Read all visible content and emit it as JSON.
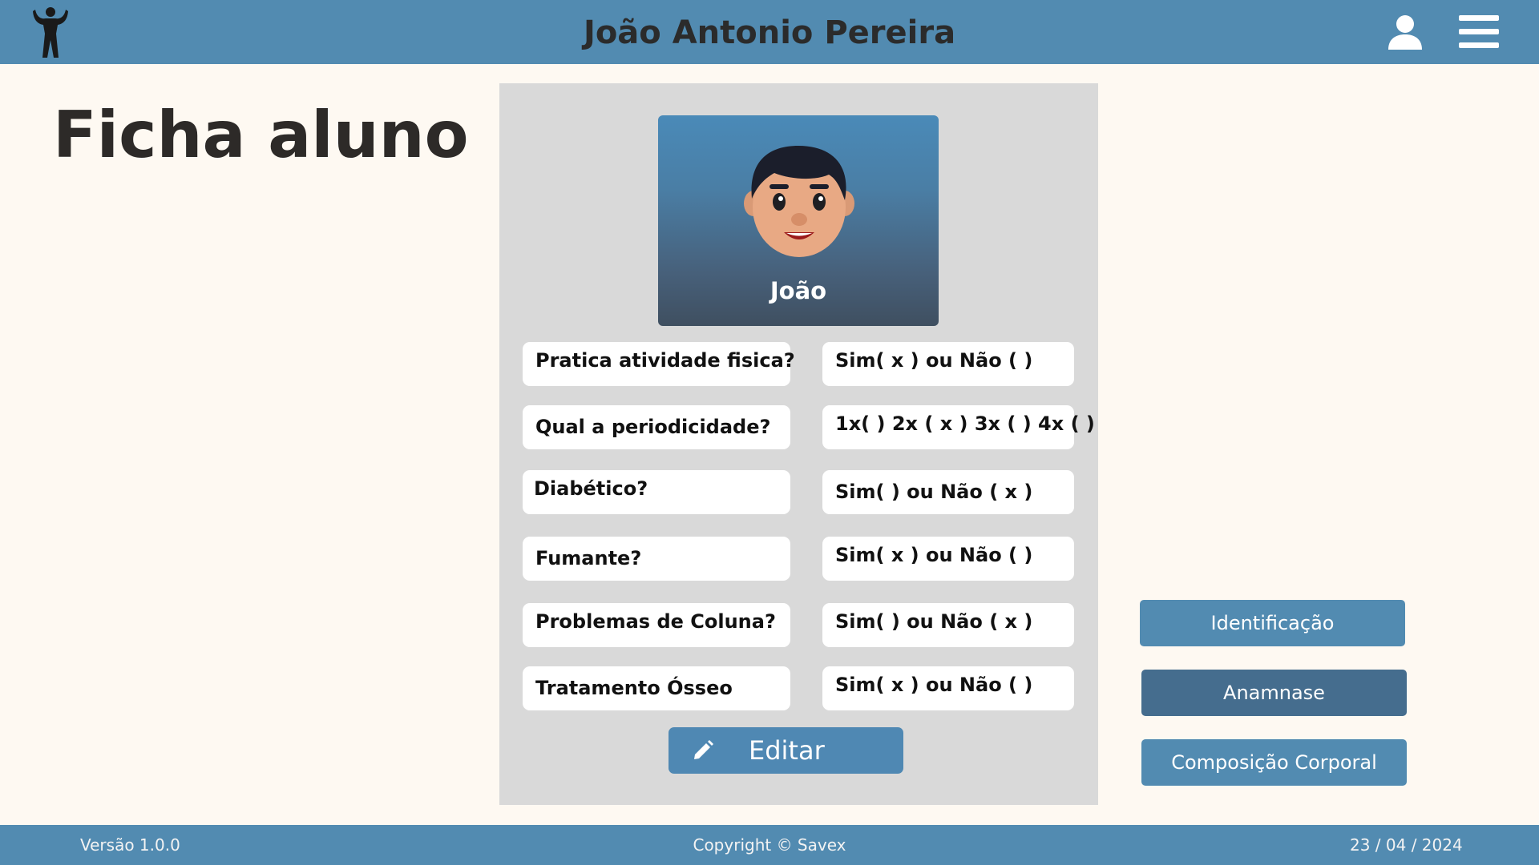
{
  "header": {
    "title": "João Antonio Pereira",
    "logo_icon": "bodybuilder-silhouette-icon",
    "user_icon": "user-icon",
    "menu_icon": "hamburger-menu-icon"
  },
  "page": {
    "title": "Ficha aluno"
  },
  "profile": {
    "name": "João",
    "avatar_icon": "boy-avatar-icon"
  },
  "anamnese": [
    {
      "question": "Pratica atividade fisica?",
      "answer": "Sim( x ) ou Não (  )"
    },
    {
      "question": "Qual a periodicidade?",
      "answer": "1x(  ) 2x ( x ) 3x (  ) 4x (  )"
    },
    {
      "question": "Diabético?",
      "answer": "Sim(  ) ou Não ( x )"
    },
    {
      "question": "Fumante?",
      "answer": "Sim( x ) ou Não (  )"
    },
    {
      "question": "Problemas de Coluna?",
      "answer": "Sim(  ) ou Não ( x )"
    },
    {
      "question": "Tratamento Ósseo",
      "answer": "Sim( x ) ou Não (  )"
    }
  ],
  "edit_button": {
    "label": "Editar",
    "icon": "pencil-icon"
  },
  "side_nav": {
    "identificacao": "Identificação",
    "anamnese": "Anamnase",
    "composicao": "Composição Corporal"
  },
  "footer": {
    "version": "Versão 1.0.0",
    "copyright": "Copyright © Savex",
    "date": "23 / 04 / 2024"
  },
  "colors": {
    "header": "#528bb1",
    "background": "#fef9f2",
    "panel": "#d9d9d9",
    "active_nav": "#456d8e"
  }
}
